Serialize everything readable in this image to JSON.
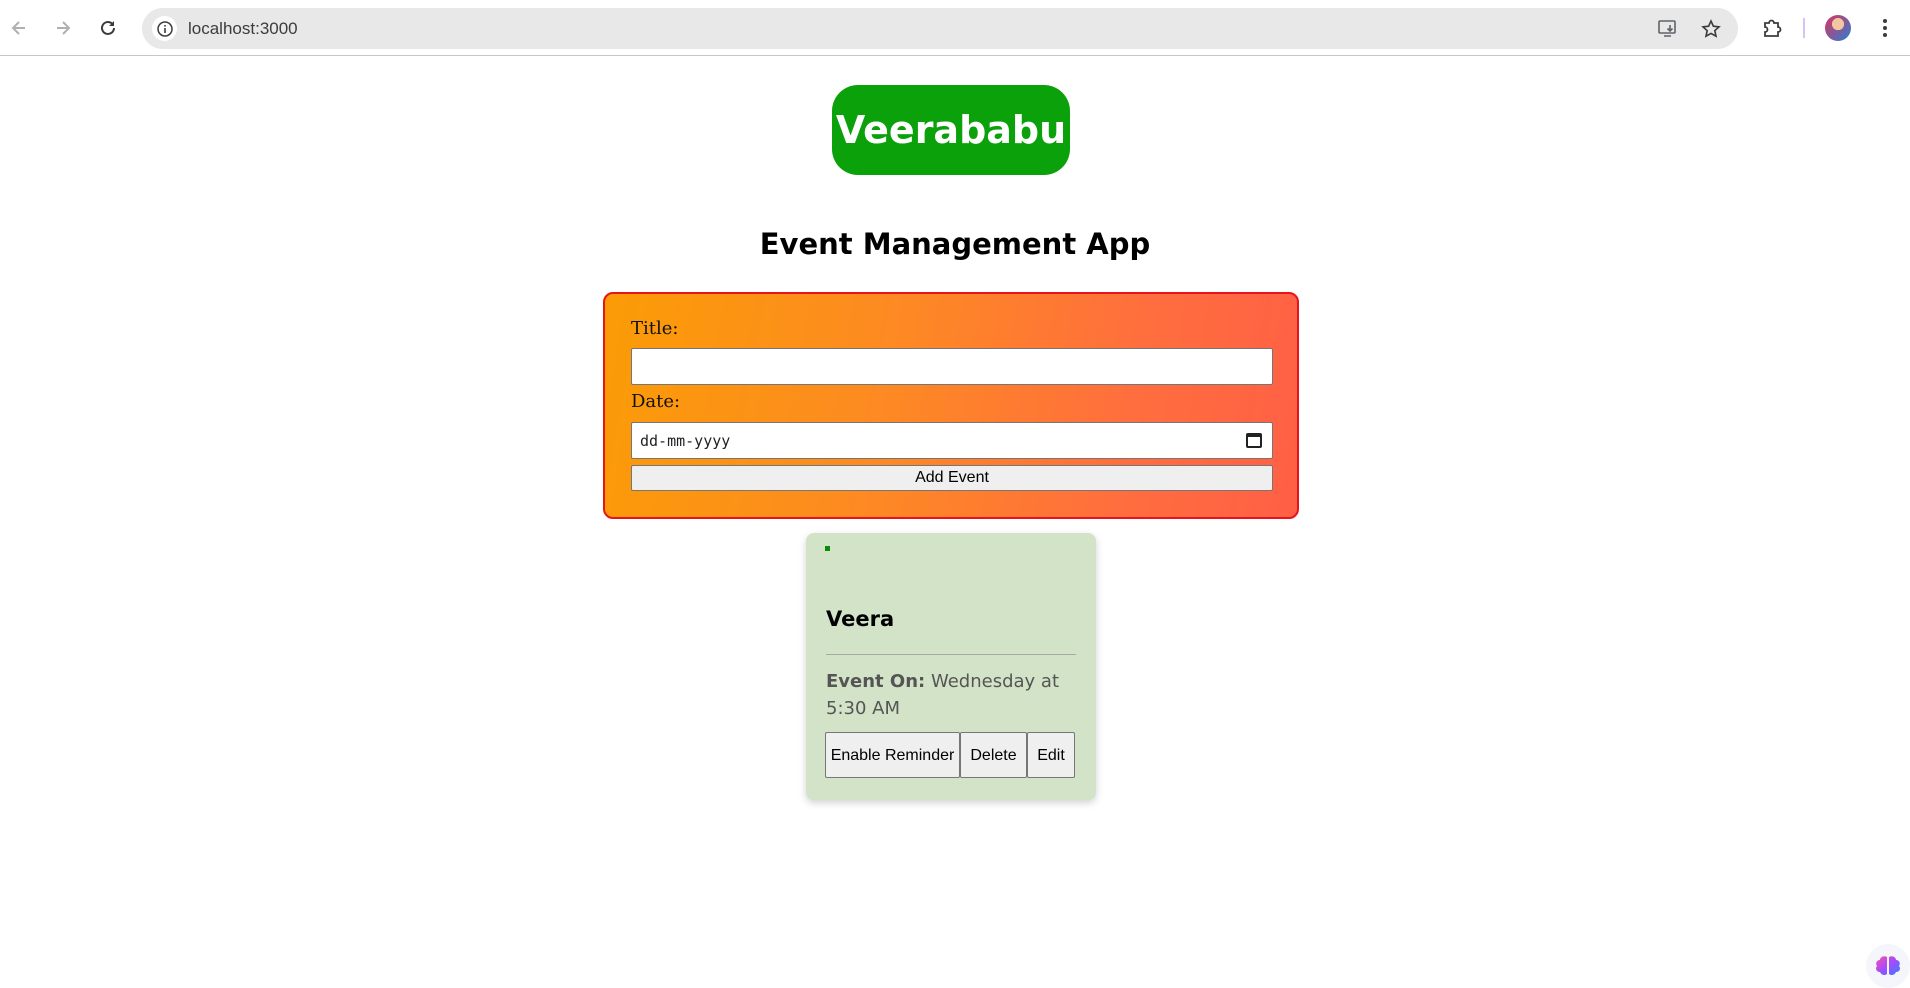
{
  "browser": {
    "url": "localhost:3000",
    "icons": {
      "back": "arrow-left-icon",
      "forward": "arrow-right-icon",
      "reload": "reload-icon",
      "site_info": "info-icon",
      "install": "install-app-icon",
      "bookmark": "star-icon",
      "extensions": "puzzle-icon",
      "profile": "avatar",
      "menu": "kebab-menu-icon"
    }
  },
  "brand": {
    "name": "Veerababu",
    "color": "#0aa10a"
  },
  "app": {
    "title": "Event Management App"
  },
  "form": {
    "title_label": "Title:",
    "title_value": "",
    "date_label": "Date:",
    "date_placeholder": "dd-mm-yyyy",
    "submit_label": "Add Event"
  },
  "events": [
    {
      "title": "Veera",
      "event_on_label": "Event On:",
      "event_on_value": "Wednesday at 5:30 AM",
      "actions": {
        "reminder": "Enable Reminder",
        "delete": "Delete",
        "edit": "Edit"
      }
    }
  ]
}
